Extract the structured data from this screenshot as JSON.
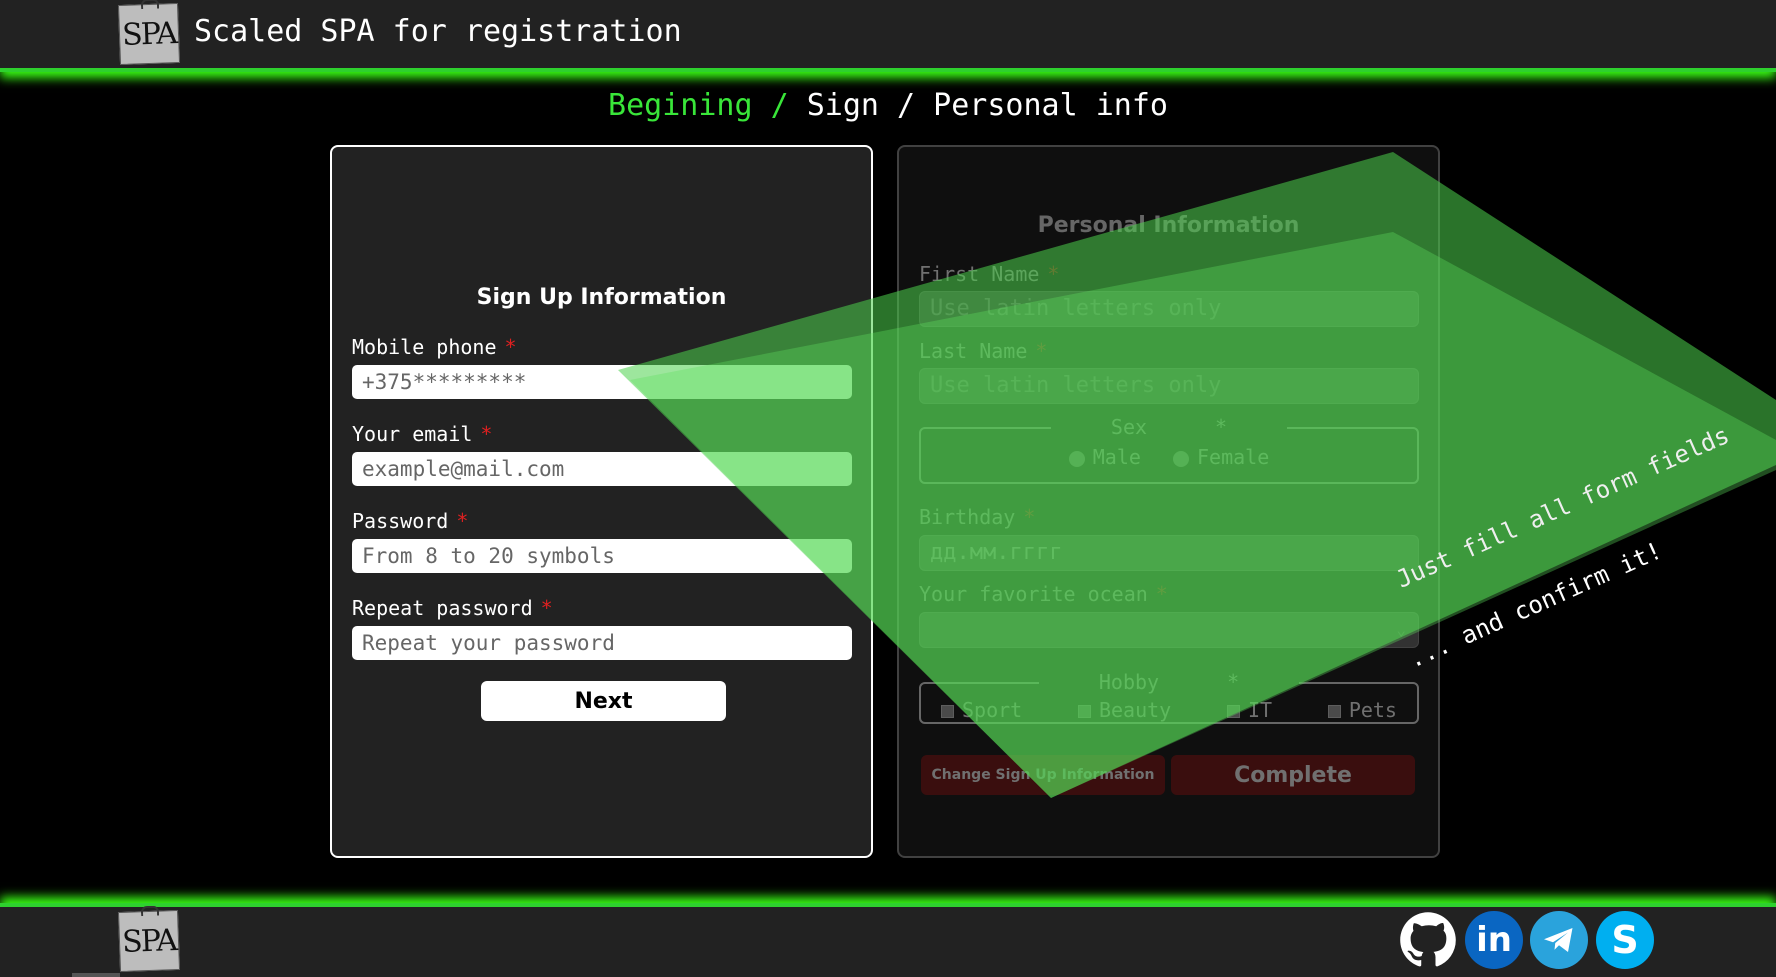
{
  "header": {
    "app_title": "Scaled SPA for registration",
    "logo_text": "SPA"
  },
  "breadcrumb": {
    "items": [
      "Begining",
      "Sign",
      "Personal info"
    ],
    "separator": "/"
  },
  "signup": {
    "title": "Sign Up Information",
    "required_mark": "*",
    "fields": [
      {
        "label": "Mobile phone",
        "placeholder": "+375*********"
      },
      {
        "label": "Your email",
        "placeholder": "example@mail.com"
      },
      {
        "label": "Password",
        "placeholder": "From 8 to 20 symbols"
      },
      {
        "label": "Repeat password",
        "placeholder": "Repeat your password"
      }
    ],
    "next_label": "Next"
  },
  "personal": {
    "title": "Personal Information",
    "first_name": {
      "label": "First Name",
      "placeholder": "Use latin letters only"
    },
    "last_name": {
      "label": "Last Name",
      "placeholder": "Use latin letters only"
    },
    "sex": {
      "legend": "Sex",
      "options": [
        "Male",
        "Female"
      ]
    },
    "birthday": {
      "label": "Birthday",
      "placeholder": "дд.мм.гггг"
    },
    "ocean": {
      "label": "Your favorite ocean",
      "value": ""
    },
    "hobby": {
      "legend": "Hobby",
      "options": [
        "Sport",
        "Beauty",
        "IT",
        "Pets"
      ]
    },
    "change_label": "Change Sign Up Information",
    "complete_label": "Complete"
  },
  "overlay": {
    "line1": "Just fill all form fields",
    "line2": "... and confirm it!"
  },
  "footer": {
    "logo_text": "SPA",
    "social": [
      "github-icon",
      "linkedin-icon",
      "telegram-icon",
      "skype-icon"
    ],
    "social_colors": [
      "#ffffff",
      "#0a66c2",
      "#2aa3dc",
      "#00aff0"
    ]
  },
  "colors": {
    "accent": "#39e639",
    "required": "#e02020"
  }
}
